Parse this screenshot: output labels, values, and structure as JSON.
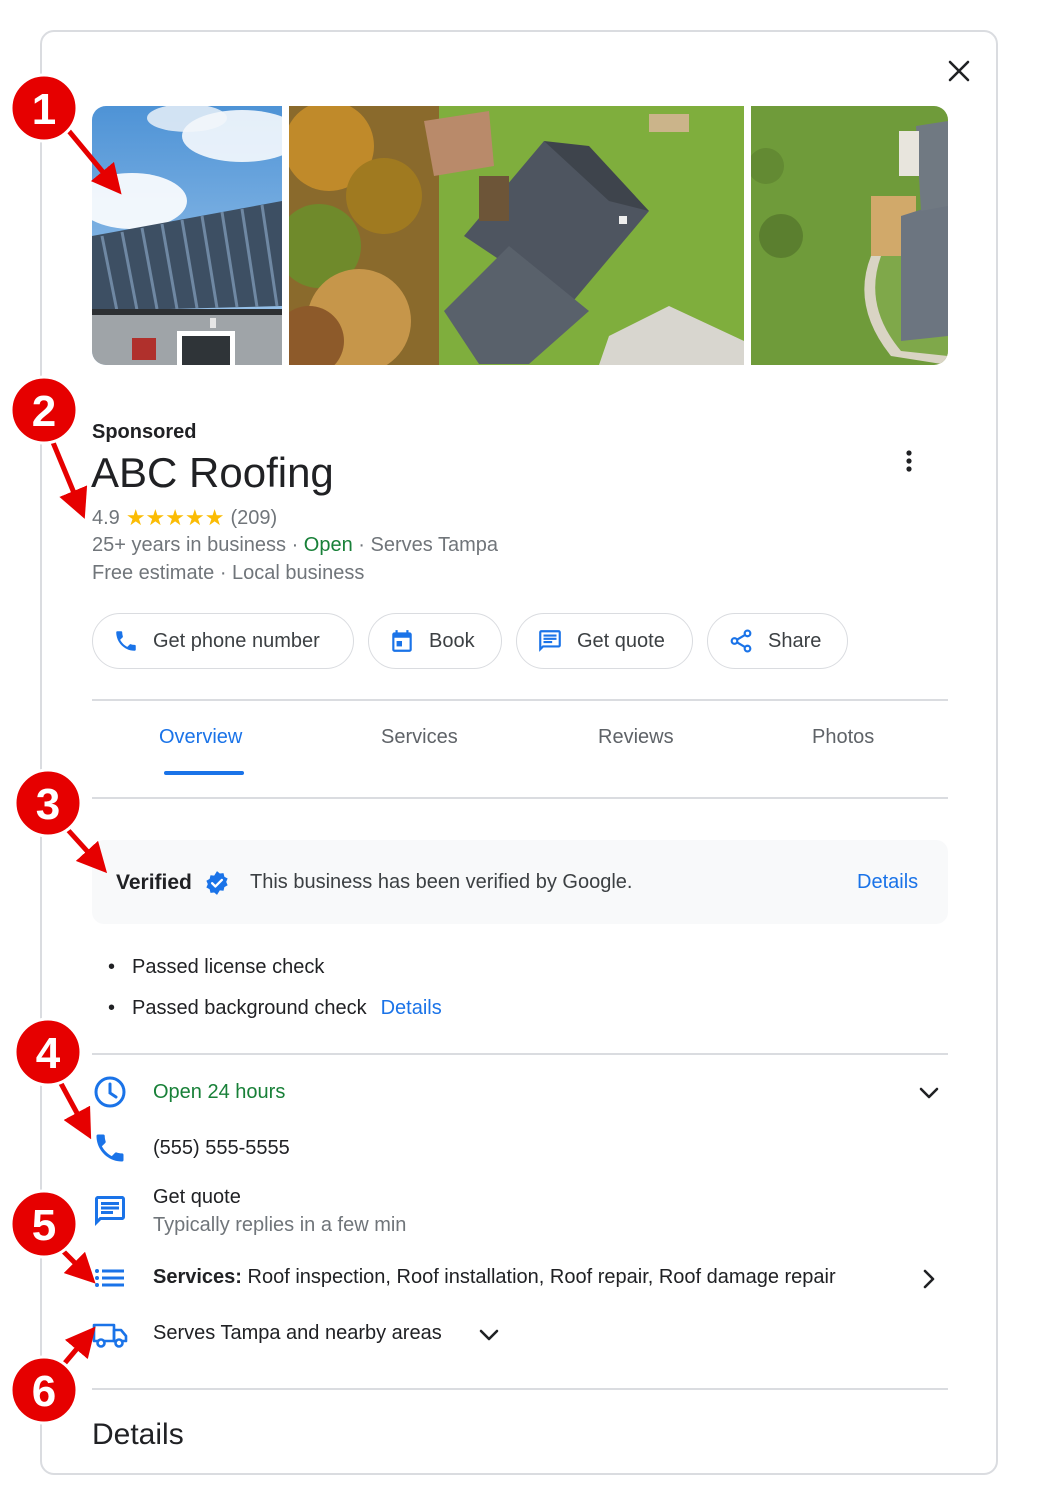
{
  "sponsored_label": "Sponsored",
  "business": {
    "name": "ABC Roofing",
    "rating": "4.9",
    "stars": "★★★★★",
    "review_count": "(209)",
    "years": "25+ years in business",
    "sep": " · ",
    "status": "Open",
    "serves": "Serves Tampa",
    "estimate": "Free estimate",
    "local": "Local business"
  },
  "actions": {
    "phone": "Get phone number",
    "book": "Book",
    "quote": "Get quote",
    "share": "Share"
  },
  "tabs": {
    "overview": "Overview",
    "services": "Services",
    "reviews": "Reviews",
    "photos": "Photos"
  },
  "verified": {
    "label": "Verified",
    "text": "This business has been verified by Google.",
    "details": "Details"
  },
  "checks": {
    "bullet": "•",
    "license": "Passed license check",
    "background": "Passed background check",
    "details": "Details"
  },
  "info": {
    "hours": "Open 24 hours",
    "phone": "(555) 555-5555",
    "quote_title": "Get quote",
    "quote_sub": "Typically replies in a few min",
    "services_label": "Services:",
    "services_list": " Roof inspection, Roof installation, Roof repair, Roof damage repair",
    "area": "Serves Tampa and nearby areas"
  },
  "details_heading": "Details",
  "markers": [
    "1",
    "2",
    "3",
    "4",
    "5",
    "6"
  ],
  "colors": {
    "accent": "#1a73e8",
    "open_green": "#188038",
    "star": "#fbbc04",
    "marker_red": "#e60000"
  }
}
